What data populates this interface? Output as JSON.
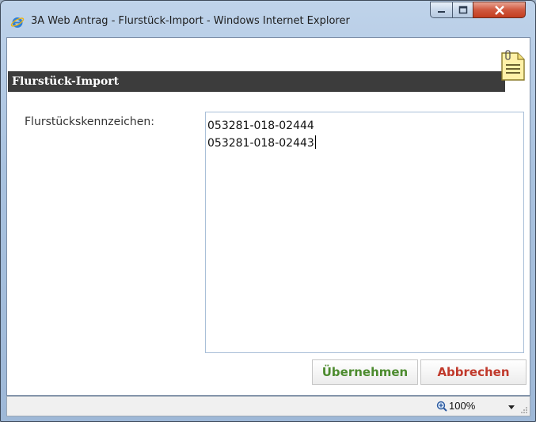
{
  "window": {
    "title": "3A Web Antrag - Flurstück-Import - Windows Internet Explorer"
  },
  "dialog": {
    "header": "Flurstück-Import",
    "field_label": "Flurstückskennzeichen:",
    "field_lines": [
      "053281-018-02444",
      "053281-018-02443"
    ],
    "ok_label": "Übernehmen",
    "cancel_label": "Abbrechen"
  },
  "statusbar": {
    "zoom": "100%"
  },
  "colors": {
    "ok": "#4c8b2e",
    "cancel": "#c0392b",
    "header_bg": "#3c3c3c"
  }
}
